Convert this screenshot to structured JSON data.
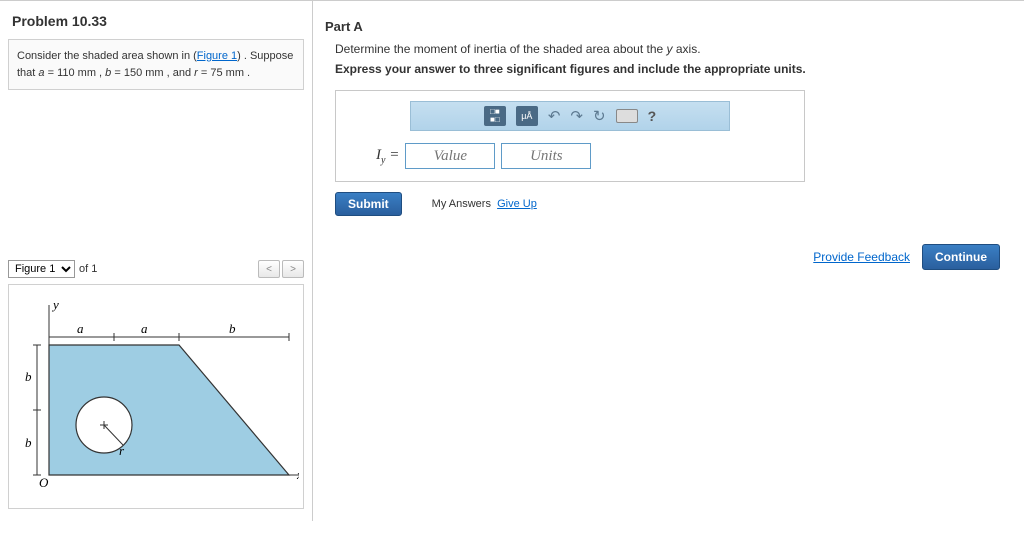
{
  "problem": {
    "title": "Problem 10.33",
    "text_before": "Consider the shaded area shown in (",
    "figure_link": "Figure 1",
    "text_after": ") . Suppose that ",
    "var_a": "a",
    "val_a": " = 110 mm",
    "var_b": "b",
    "val_b": " = 150 mm",
    "var_r": "r",
    "val_r": " = 75 mm",
    "sep": " , ",
    "and": " , and ",
    "period": " ."
  },
  "figure": {
    "select_label": "Figure 1",
    "of": "of 1",
    "prev": "<",
    "next": ">",
    "labels": {
      "a": "a",
      "b": "b",
      "r": "r",
      "x": "x",
      "y": "y",
      "O": "O"
    }
  },
  "part": {
    "label": "Part A",
    "instruction": "Determine the moment of inertia of the shaded area about the ",
    "axis_var": "y",
    "instruction_end": " axis.",
    "bold": "Express your answer to three significant figures and include the appropriate units."
  },
  "toolbar": {
    "template": "□",
    "mu": "μÅ",
    "undo": "↶",
    "redo": "↷",
    "reset": "↻",
    "keyboard": "⌨",
    "help": "?"
  },
  "answer": {
    "symbol": "I",
    "subscript": "y",
    "equals": " = ",
    "value_placeholder": "Value",
    "units_placeholder": "Units"
  },
  "buttons": {
    "submit": "Submit",
    "my_answers": "My Answers",
    "give_up": "Give Up",
    "feedback": "Provide Feedback",
    "continue": "Continue"
  }
}
